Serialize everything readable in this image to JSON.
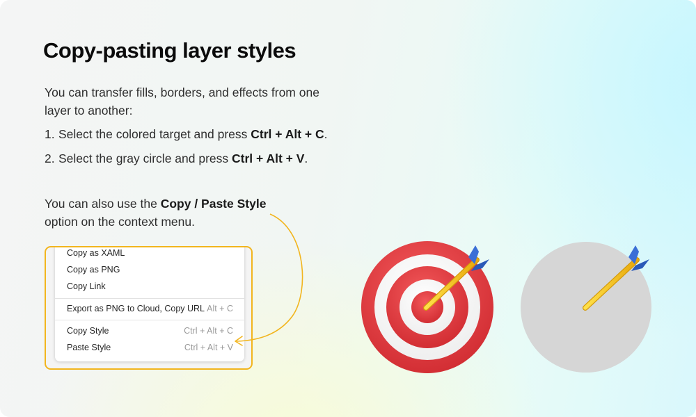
{
  "title": "Copy-pasting layer styles",
  "intro": "You can transfer fills, borders, and effects from one layer to another:",
  "steps": [
    {
      "num": "1.",
      "text_before": "Select the colored target and press ",
      "keys": "Ctrl + Alt + C",
      "text_after": "."
    },
    {
      "num": "2.",
      "text_before": "Select the gray circle and press ",
      "keys": "Ctrl + Alt + V",
      "text_after": "."
    }
  ],
  "also": {
    "before": "You can also use the ",
    "bold": "Copy / Paste Style",
    "after": " option on the context menu."
  },
  "context_menu": {
    "items": [
      {
        "label": "Copy as XAML",
        "shortcut": ""
      },
      {
        "label": "Copy as PNG",
        "shortcut": ""
      },
      {
        "label": "Copy Link",
        "shortcut": ""
      },
      {
        "label": "Export as PNG to Cloud, Copy URL",
        "shortcut": "Alt + C"
      },
      {
        "label": "Copy Style",
        "shortcut": "Ctrl + Alt + C"
      },
      {
        "label": "Paste Style",
        "shortcut": "Ctrl + Alt + V"
      }
    ]
  },
  "icons": {
    "colored_target": "target-with-arrow-icon",
    "gray_circle": "gray-circle-with-arrow-icon"
  },
  "colors": {
    "highlight_border": "#f2b51e",
    "target_red": "#e63b3e",
    "gray_circle": "#d6d6d6",
    "arrow_shaft": "#f6c51c",
    "arrow_fletching": "#2f62c9"
  }
}
